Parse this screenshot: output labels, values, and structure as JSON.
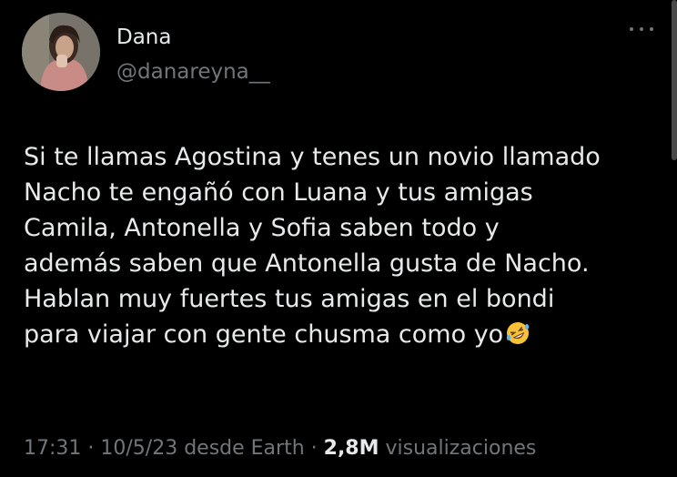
{
  "author": {
    "display_name": "Dana",
    "handle": "@danareyna__"
  },
  "tweet": {
    "lines": [
      "Si te llamas Agostina y tenes un novio llamado",
      "Nacho te engañó con Luana y tus amigas",
      "Camila, Antonella y Sofia saben todo y",
      "además saben que Antonella gusta de Nacho.",
      "Hablan muy fuertes tus amigas en el bondi",
      "para viajar con gente chusma como yo"
    ],
    "emoji_icon": "rolling-on-floor-laughing-emoji"
  },
  "meta": {
    "time": "17:31",
    "sep1": " · ",
    "date": "10/5/23",
    "source": " desde Earth",
    "sep2": " · ",
    "views_count": "2,8M",
    "views_label": " visualizaciones"
  },
  "colors": {
    "background": "#000000",
    "text": "#e7e9ea",
    "secondary": "#71767b"
  }
}
